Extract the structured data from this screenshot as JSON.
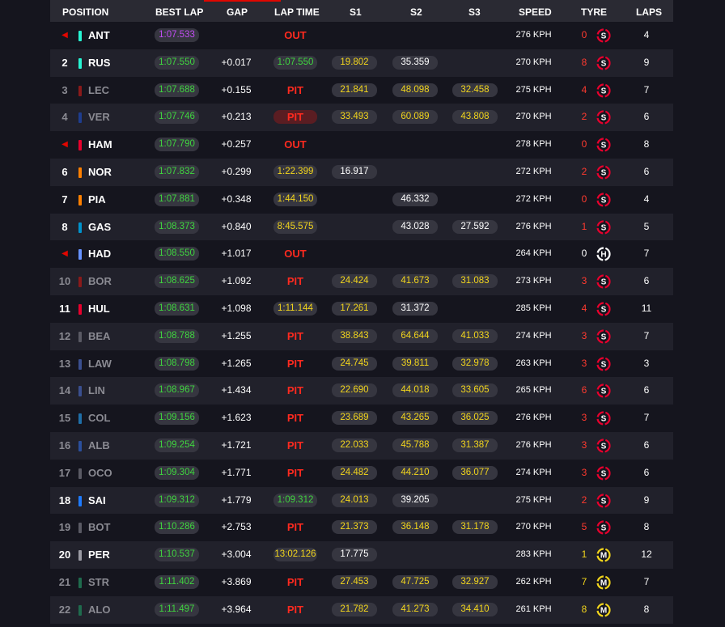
{
  "header": {
    "position": "POSITION",
    "best_lap": "BEST LAP",
    "gap": "GAP",
    "lap_time": "LAP TIME",
    "s1": "S1",
    "s2": "S2",
    "s3": "S3",
    "speed": "SPEED",
    "tyre": "TYRE",
    "laps": "LAPS"
  },
  "colors": {
    "accent_red": "#e10600",
    "sector_yellow": "#f2d51c",
    "personal_best_green": "#3fd43f",
    "fastest_purple": "#c04cf2",
    "soft_tyre": "#e8002d",
    "medium_tyre": "#f2d51c",
    "hard_tyre": "#ffffff"
  },
  "rows": [
    {
      "pos": "◀",
      "code": "ANT",
      "team_color": "#27f4d2",
      "best": "1:07.533",
      "best_purple": true,
      "gap": "",
      "status": "OUT",
      "lap_time": "",
      "s1": "",
      "s2": "",
      "s3": "",
      "speed": "276 KPH",
      "tyre_age": "0",
      "tyre": "S",
      "tyre_icon": "soft-tyre-icon",
      "laps": "4"
    },
    {
      "pos": "2",
      "code": "RUS",
      "team_color": "#27f4d2",
      "best": "1:07.550",
      "gap": "+0.017",
      "status": "",
      "lap_time": "1:07.550",
      "lap_green": true,
      "s1": "19.802",
      "s2": "35.359",
      "s2_white": true,
      "s3": "",
      "speed": "270 KPH",
      "tyre_age": "8",
      "tyre": "S",
      "tyre_icon": "soft-tyre-icon",
      "laps": "9"
    },
    {
      "pos": "3",
      "code": "LEC",
      "team_color": "#8b1a1a",
      "best": "1:07.688",
      "gap": "+0.155",
      "status": "PIT",
      "lap_time": "",
      "s1": "21.841",
      "s2": "48.098",
      "s3": "32.458",
      "speed": "275 KPH",
      "tyre_age": "4",
      "tyre": "S",
      "tyre_icon": "soft-tyre-icon",
      "laps": "7",
      "pit": true
    },
    {
      "pos": "4",
      "code": "VER",
      "team_color": "#1e3d8f",
      "best": "1:07.746",
      "gap": "+0.213",
      "status": "PIT",
      "status_boxed": true,
      "lap_time": "",
      "s1": "33.493",
      "s2": "60.089",
      "s3": "43.808",
      "speed": "270 KPH",
      "tyre_age": "2",
      "tyre": "S",
      "tyre_icon": "soft-tyre-icon",
      "laps": "6",
      "pit": true
    },
    {
      "pos": "◀",
      "code": "HAM",
      "team_color": "#e8002d",
      "best": "1:07.790",
      "gap": "+0.257",
      "status": "OUT",
      "lap_time": "",
      "s1": "",
      "s2": "",
      "s3": "",
      "speed": "278 KPH",
      "tyre_age": "0",
      "tyre": "S",
      "tyre_icon": "soft-tyre-icon",
      "laps": "8"
    },
    {
      "pos": "6",
      "code": "NOR",
      "team_color": "#ff8000",
      "best": "1:07.832",
      "gap": "+0.299",
      "status": "",
      "lap_time": "1:22.399",
      "s1": "16.917",
      "s1_white": true,
      "s2": "",
      "s3": "",
      "speed": "272 KPH",
      "tyre_age": "2",
      "tyre": "S",
      "tyre_icon": "soft-tyre-icon",
      "laps": "6"
    },
    {
      "pos": "7",
      "code": "PIA",
      "team_color": "#ff8000",
      "best": "1:07.881",
      "gap": "+0.348",
      "status": "",
      "lap_time": "1:44.150",
      "s1": "",
      "s2": "46.332",
      "s2_white": true,
      "s3": "",
      "speed": "272 KPH",
      "tyre_age": "0",
      "tyre": "S",
      "tyre_icon": "soft-tyre-icon",
      "laps": "4"
    },
    {
      "pos": "8",
      "code": "GAS",
      "team_color": "#0093cc",
      "best": "1:08.373",
      "gap": "+0.840",
      "status": "",
      "lap_time": "8:45.575",
      "s1": "",
      "s2": "43.028",
      "s2_white": true,
      "s3": "27.592",
      "s3_white": true,
      "speed": "276 KPH",
      "tyre_age": "1",
      "tyre": "S",
      "tyre_icon": "soft-tyre-icon",
      "laps": "5"
    },
    {
      "pos": "◀",
      "code": "HAD",
      "team_color": "#6692ff",
      "best": "1:08.550",
      "gap": "+1.017",
      "status": "OUT",
      "lap_time": "",
      "s1": "",
      "s2": "",
      "s3": "",
      "speed": "264 KPH",
      "tyre_age": "0",
      "tyre_age_white": true,
      "tyre": "H",
      "tyre_icon": "hard-tyre-icon",
      "laps": "7"
    },
    {
      "pos": "10",
      "code": "BOR",
      "team_color": "#8b1a1a",
      "best": "1:08.625",
      "gap": "+1.092",
      "status": "PIT",
      "lap_time": "",
      "s1": "24.424",
      "s2": "41.673",
      "s3": "31.083",
      "speed": "273 KPH",
      "tyre_age": "3",
      "tyre": "S",
      "tyre_icon": "soft-tyre-icon",
      "laps": "6",
      "pit": true
    },
    {
      "pos": "11",
      "code": "HUL",
      "team_color": "#e8002d",
      "best": "1:08.631",
      "gap": "+1.098",
      "status": "",
      "lap_time": "1:11.144",
      "s1": "17.261",
      "s2": "31.372",
      "s2_white": true,
      "s3": "",
      "speed": "285 KPH",
      "tyre_age": "4",
      "tyre": "S",
      "tyre_icon": "soft-tyre-icon",
      "laps": "11"
    },
    {
      "pos": "12",
      "code": "BEA",
      "team_color": "#5a5a64",
      "best": "1:08.788",
      "gap": "+1.255",
      "status": "PIT",
      "lap_time": "",
      "s1": "38.843",
      "s2": "64.644",
      "s3": "41.033",
      "speed": "274 KPH",
      "tyre_age": "3",
      "tyre": "S",
      "tyre_icon": "soft-tyre-icon",
      "laps": "7",
      "pit": true
    },
    {
      "pos": "13",
      "code": "LAW",
      "team_color": "#3a4f8f",
      "best": "1:08.798",
      "gap": "+1.265",
      "status": "PIT",
      "lap_time": "",
      "s1": "24.745",
      "s2": "39.811",
      "s3": "32.978",
      "speed": "263 KPH",
      "tyre_age": "3",
      "tyre": "S",
      "tyre_icon": "soft-tyre-icon",
      "laps": "3",
      "pit": true
    },
    {
      "pos": "14",
      "code": "LIN",
      "team_color": "#3a4f8f",
      "best": "1:08.967",
      "gap": "+1.434",
      "status": "PIT",
      "lap_time": "",
      "s1": "22.690",
      "s2": "44.018",
      "s3": "33.605",
      "speed": "265 KPH",
      "tyre_age": "6",
      "tyre": "S",
      "tyre_icon": "soft-tyre-icon",
      "laps": "6",
      "pit": true
    },
    {
      "pos": "15",
      "code": "COL",
      "team_color": "#1f6fa8",
      "best": "1:09.156",
      "gap": "+1.623",
      "status": "PIT",
      "lap_time": "",
      "s1": "23.689",
      "s2": "43.265",
      "s3": "36.025",
      "speed": "276 KPH",
      "tyre_age": "3",
      "tyre": "S",
      "tyre_icon": "soft-tyre-icon",
      "laps": "7",
      "pit": true
    },
    {
      "pos": "16",
      "code": "ALB",
      "team_color": "#2b4f9c",
      "best": "1:09.254",
      "gap": "+1.721",
      "status": "PIT",
      "lap_time": "",
      "s1": "22.033",
      "s2": "45.788",
      "s3": "31.387",
      "speed": "276 KPH",
      "tyre_age": "3",
      "tyre": "S",
      "tyre_icon": "soft-tyre-icon",
      "laps": "6",
      "pit": true
    },
    {
      "pos": "17",
      "code": "OCO",
      "team_color": "#5a5a64",
      "best": "1:09.304",
      "gap": "+1.771",
      "status": "PIT",
      "lap_time": "",
      "s1": "24.482",
      "s2": "44.210",
      "s3": "36.077",
      "speed": "274 KPH",
      "tyre_age": "3",
      "tyre": "S",
      "tyre_icon": "soft-tyre-icon",
      "laps": "6",
      "pit": true
    },
    {
      "pos": "18",
      "code": "SAI",
      "team_color": "#1e7bff",
      "best": "1:09.312",
      "gap": "+1.779",
      "status": "",
      "lap_time": "1:09.312",
      "lap_green": true,
      "s1": "24.013",
      "s2": "39.205",
      "s2_white": true,
      "s3": "",
      "speed": "275 KPH",
      "tyre_age": "2",
      "tyre": "S",
      "tyre_icon": "soft-tyre-icon",
      "laps": "9"
    },
    {
      "pos": "19",
      "code": "BOT",
      "team_color": "#5a5a64",
      "best": "1:10.286",
      "gap": "+2.753",
      "status": "PIT",
      "lap_time": "",
      "s1": "21.373",
      "s2": "36.148",
      "s3": "31.178",
      "speed": "270 KPH",
      "tyre_age": "5",
      "tyre": "S",
      "tyre_icon": "soft-tyre-icon",
      "laps": "8",
      "pit": true
    },
    {
      "pos": "20",
      "code": "PER",
      "team_color": "#9a9aa3",
      "best": "1:10.537",
      "gap": "+3.004",
      "status": "",
      "lap_time": "13:02.126",
      "s1": "17.775",
      "s1_white": true,
      "s2": "",
      "s3": "",
      "speed": "283 KPH",
      "tyre_age": "1",
      "tyre_age_yellow": true,
      "tyre": "M",
      "tyre_icon": "medium-tyre-icon",
      "laps": "12"
    },
    {
      "pos": "21",
      "code": "STR",
      "team_color": "#1f6b4d",
      "best": "1:11.402",
      "gap": "+3.869",
      "status": "PIT",
      "lap_time": "",
      "s1": "27.453",
      "s2": "47.725",
      "s3": "32.927",
      "speed": "262 KPH",
      "tyre_age": "7",
      "tyre_age_yellow": true,
      "tyre": "M",
      "tyre_icon": "medium-tyre-icon",
      "laps": "7",
      "pit": true
    },
    {
      "pos": "22",
      "code": "ALO",
      "team_color": "#1f6b4d",
      "best": "1:11.497",
      "gap": "+3.964",
      "status": "PIT",
      "lap_time": "",
      "s1": "21.782",
      "s2": "41.273",
      "s3": "34.410",
      "speed": "261 KPH",
      "tyre_age": "8",
      "tyre_age_yellow": true,
      "tyre": "M",
      "tyre_icon": "medium-tyre-icon",
      "laps": "8",
      "pit": true
    }
  ]
}
